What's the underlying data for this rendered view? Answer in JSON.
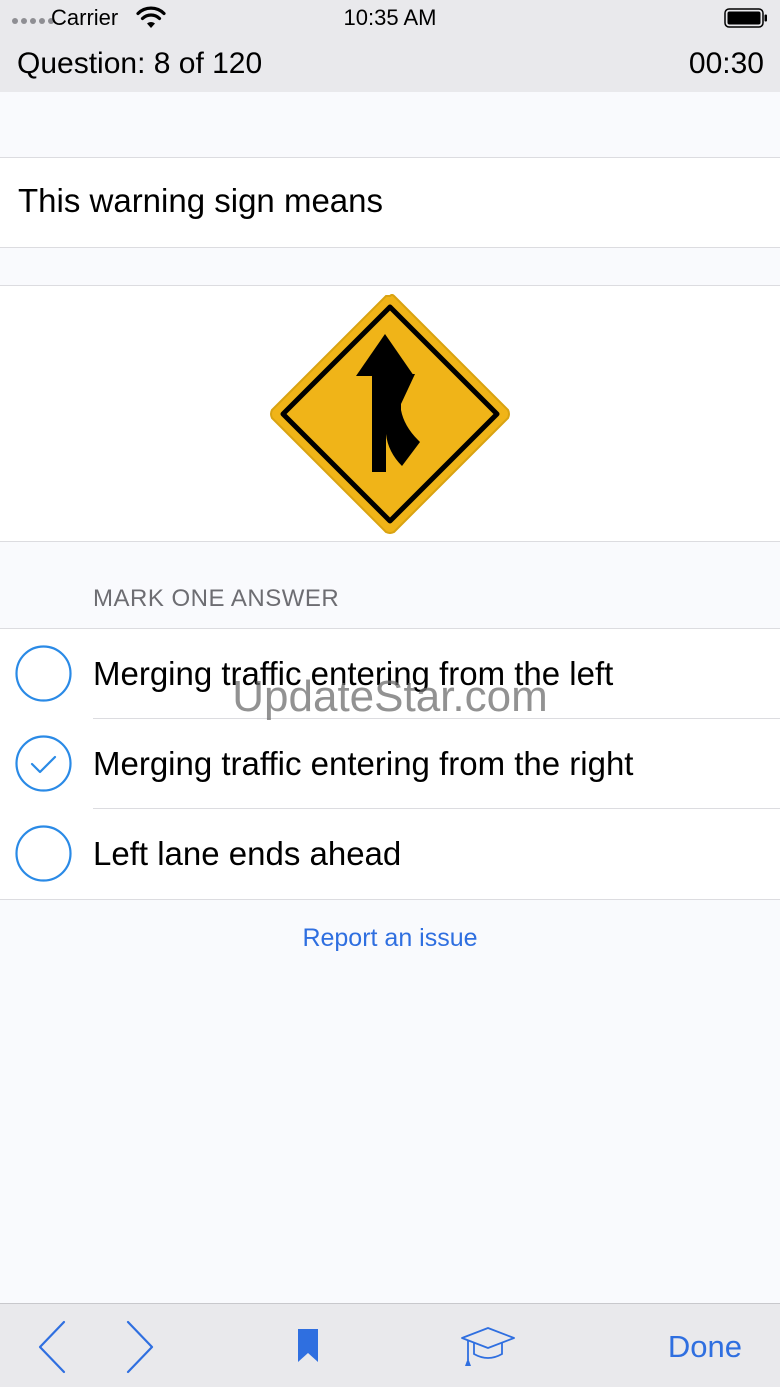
{
  "status_bar": {
    "carrier": "Carrier",
    "time": "10:35 AM"
  },
  "header": {
    "question_counter": "Question: 8 of 120",
    "timer": "00:30"
  },
  "question": {
    "text": "This warning sign means",
    "image_icon": "merge-from-right-sign-icon"
  },
  "answers_section": {
    "header": "MARK ONE ANSWER",
    "options": [
      {
        "label": "Merging traffic entering from the left",
        "selected": false
      },
      {
        "label": "Merging traffic entering from the right",
        "selected": true
      },
      {
        "label": "Left lane ends ahead",
        "selected": false
      }
    ]
  },
  "watermark": "UpdateStar.com",
  "report_link": "Report an issue",
  "toolbar": {
    "done_label": "Done",
    "icons": [
      "chevron-left-icon",
      "chevron-right-icon",
      "bookmark-icon",
      "graduation-cap-icon"
    ]
  },
  "colors": {
    "accent": "#2f6fe0",
    "radio": "#2a8ae6",
    "sign_yellow": "#f0b418",
    "bar_gray": "#e9e9ec",
    "background": "#f9fafd"
  }
}
